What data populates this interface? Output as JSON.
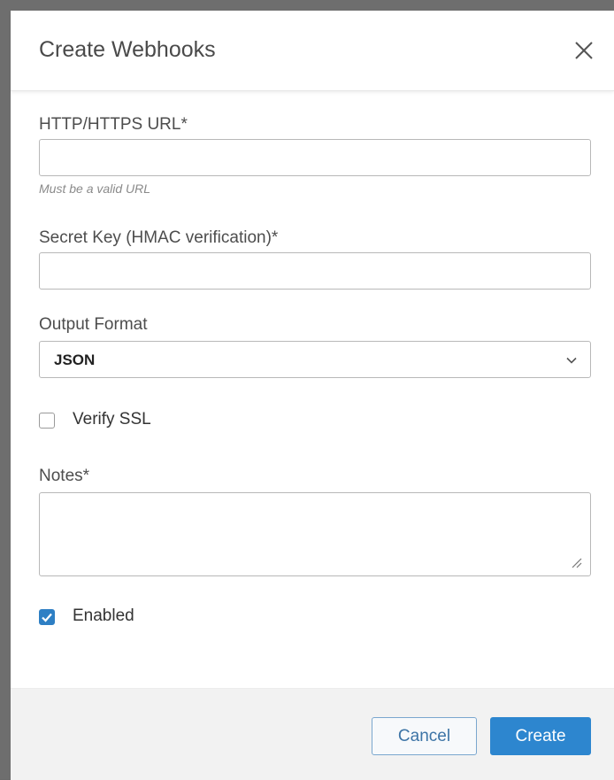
{
  "dialog": {
    "title": "Create Webhooks",
    "close_icon": "close-icon"
  },
  "form": {
    "url": {
      "label": "HTTP/HTTPS URL*",
      "value": "",
      "placeholder": "",
      "help": "Must be a valid URL"
    },
    "secret_key": {
      "label": "Secret Key (HMAC verification)*",
      "value": "",
      "placeholder": ""
    },
    "output_format": {
      "label": "Output Format",
      "selected": "JSON",
      "icon": "chevron-down-icon"
    },
    "verify_ssl": {
      "label": "Verify SSL",
      "checked": false
    },
    "notes": {
      "label": "Notes*",
      "value": ""
    },
    "enabled": {
      "label": "Enabled",
      "checked": true
    }
  },
  "footer": {
    "cancel_label": "Cancel",
    "create_label": "Create"
  },
  "colors": {
    "primary": "#2d86cf",
    "checkbox_checked": "#2e7fc4",
    "footer_bg": "#f2f2f2",
    "backdrop": "#6e6e6e"
  }
}
